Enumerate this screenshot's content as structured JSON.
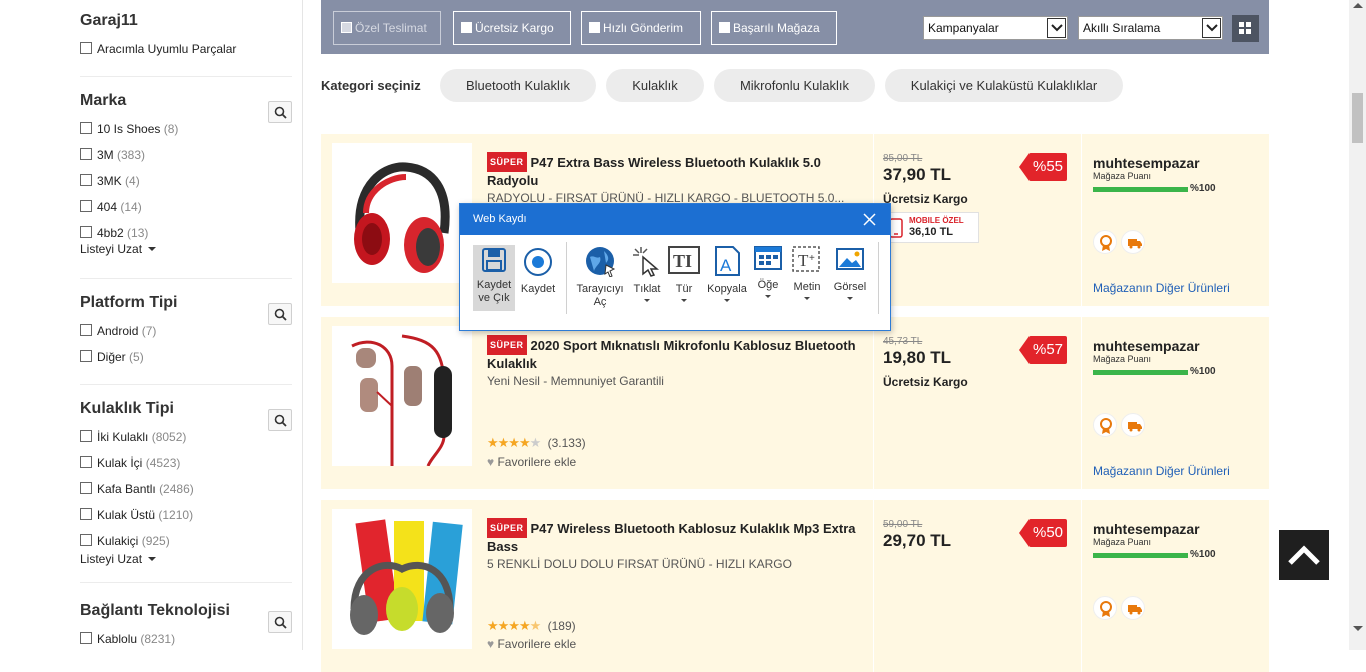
{
  "sidebar": {
    "garaj": {
      "title": "Garaj11",
      "option": "Aracımla Uyumlu Parçalar"
    },
    "marka": {
      "title": "Marka",
      "items": [
        {
          "label": "10 Is Shoes",
          "count": "(8)"
        },
        {
          "label": "3M",
          "count": "(383)"
        },
        {
          "label": "3MK",
          "count": "(4)"
        },
        {
          "label": "404",
          "count": "(14)"
        },
        {
          "label": "4bb2",
          "count": "(13)"
        }
      ],
      "more": "Listeyi Uzat"
    },
    "platform": {
      "title": "Platform Tipi",
      "items": [
        {
          "label": "Android",
          "count": "(7)"
        },
        {
          "label": "Diğer",
          "count": "(5)"
        }
      ]
    },
    "kulaklik": {
      "title": "Kulaklık Tipi",
      "items": [
        {
          "label": "İki Kulaklı",
          "count": "(8052)"
        },
        {
          "label": "Kulak İçi",
          "count": "(4523)"
        },
        {
          "label": "Kafa Bantlı",
          "count": "(2486)"
        },
        {
          "label": "Kulak Üstü",
          "count": "(1210)"
        },
        {
          "label": "Kulakiçi",
          "count": "(925)"
        }
      ],
      "more": "Listeyi Uzat"
    },
    "baglanti": {
      "title": "Bağlantı Teknolojisi",
      "items": [
        {
          "label": "Kablolu",
          "count": "(8231)"
        }
      ]
    }
  },
  "filterbar": {
    "checks": [
      "Özel Teslimat",
      "Ücretsiz Kargo",
      "Hızlı Gönderim",
      "Başarılı Mağaza"
    ],
    "campaign_select": "Kampanyalar",
    "sort_select": "Akıllı Sıralama"
  },
  "categories": {
    "label": "Kategori seçiniz",
    "chips": [
      "Bluetooth Kulaklık",
      "Kulaklık",
      "Mikrofonlu Kulaklık",
      "Kulakiçi ve Kulaküstü Kulaklıklar"
    ]
  },
  "products": [
    {
      "badge": "SÜPER",
      "title": "P47 Extra Bass Wireless Bluetooth Kulaklık 5.0 Radyolu",
      "subtitle": "RADYOLU - FIRSAT ÜRÜNÜ - HIZLI KARGO - BLUETOOTH 5.0...",
      "old_price": "85,00 TL",
      "price": "37,90 TL",
      "shipping": "Ücretsiz Kargo",
      "mobile_label": "MOBILE ÖZEL",
      "mobile_price": "36,10 TL",
      "discount": "%55",
      "store": "muhtesempazar",
      "store_label": "Mağaza Puanı",
      "store_score": "%100",
      "store_link": "Mağazanın Diğer Ürünleri"
    },
    {
      "badge": "SÜPER",
      "title": "2020 Sport Mıknatıslı Mikrofonlu Kablosuz Bluetooth Kulaklık",
      "subtitle": "Yeni Nesil - Memnuniyet Garantili",
      "rating_stars": 4,
      "rating_count": "(3.133)",
      "favorite": "Favorilere ekle",
      "old_price": "45,73 TL",
      "price": "19,80 TL",
      "shipping": "Ücretsiz Kargo",
      "discount": "%57",
      "store": "muhtesempazar",
      "store_label": "Mağaza Puanı",
      "store_score": "%100",
      "store_link": "Mağazanın Diğer Ürünleri"
    },
    {
      "badge": "SÜPER",
      "title": "P47 Wireless Bluetooth Kablosuz Kulaklık Mp3 Extra Bass",
      "subtitle": "5 RENKLİ DOLU DOLU FIRSAT ÜRÜNÜ - HIZLI KARGO",
      "rating_stars": 4.5,
      "rating_count": "(189)",
      "favorite": "Favorilere ekle",
      "old_price": "59,00 TL",
      "price": "29,70 TL",
      "discount": "%50",
      "store": "muhtesempazar",
      "store_label": "Mağaza Puanı",
      "store_score": "%100"
    }
  ],
  "popup": {
    "title": "Web Kaydı",
    "tools": [
      {
        "label": "Kaydet\nve Çık",
        "icon": "save-icon"
      },
      {
        "label": "Kaydet",
        "icon": "record-icon"
      },
      {
        "label": "Tarayıcıyı\nAç",
        "icon": "globe-icon"
      },
      {
        "label": "Tıklat",
        "icon": "click-icon"
      },
      {
        "label": "Tür",
        "icon": "type-icon"
      },
      {
        "label": "Kopyala",
        "icon": "copy-icon"
      },
      {
        "label": "Öğe",
        "icon": "element-icon"
      },
      {
        "label": "Metin",
        "icon": "text-icon"
      },
      {
        "label": "Görsel",
        "icon": "image-icon"
      }
    ]
  },
  "colors": {
    "accent_red": "#e2242a",
    "filter_bar": "#868fa6",
    "card_bg": "#fff8e2",
    "link_blue": "#1f5fb7",
    "popup_header": "#1c6fd2"
  }
}
